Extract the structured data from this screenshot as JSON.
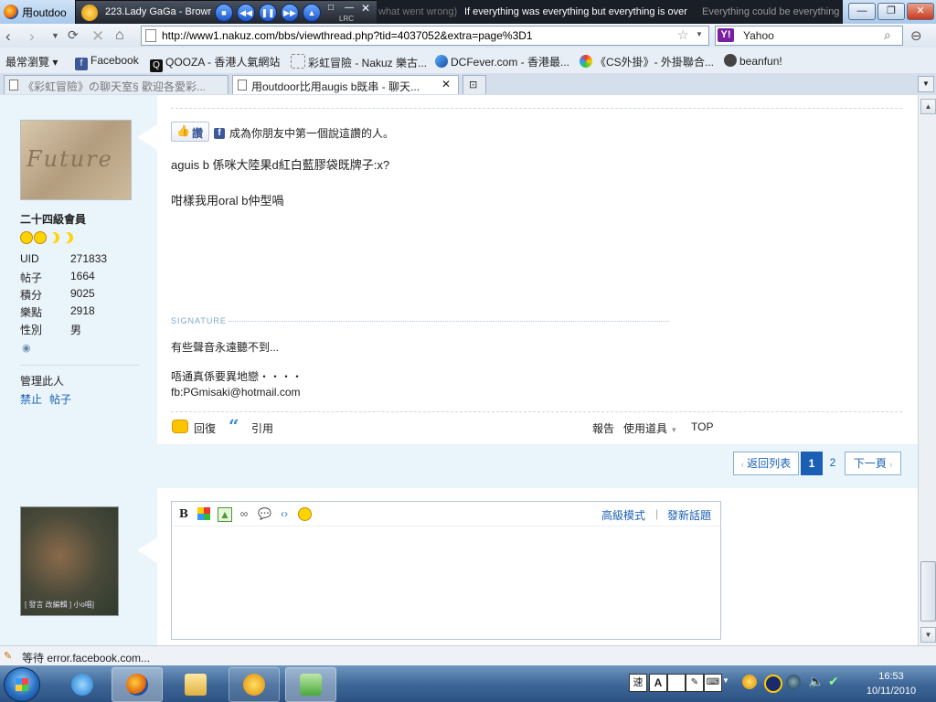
{
  "window": {
    "title": "用outdoo",
    "media_title": "223.Lady GaGa - Browr",
    "lyrics_prev": "what went wrong)",
    "lyrics_current": "If everything was everything but everything is over",
    "lyrics_next": "Everything could be everything",
    "lrc_label": "LRC"
  },
  "nav": {
    "url": "http://www1.nakuz.com/bbs/viewthread.php?tid=4037052&extra=page%3D1",
    "search_engine": "Yahoo"
  },
  "bookmarks": [
    {
      "label": "最常瀏覽",
      "color": "#e8eef6"
    },
    {
      "label": "Facebook",
      "color": "#3b5998"
    },
    {
      "label": "QOOZA - 香港人氣網站",
      "color": "#111111"
    },
    {
      "label": "彩虹冒險 - Nakuz 樂古...",
      "color": "#e8eef6"
    },
    {
      "label": "DCFever.com - 香港最...",
      "color": "#1a73c8"
    },
    {
      "label": "《CS外掛》- 外掛聯合...",
      "color": "#e8eef6"
    },
    {
      "label": "beanfun!",
      "color": "#444444"
    }
  ],
  "tabs": [
    {
      "label": "《彩虹冒險》の聊天室§ 歡迎各愛彩...",
      "active": false
    },
    {
      "label": "用outdoor比用augis b既串 - 聊天...",
      "active": true
    }
  ],
  "post": {
    "like_label": "讚",
    "like_prompt": "成為你朋友中第一個說這讚的人。",
    "line1": "aguis b 係咪大陸果d紅白藍膠袋既牌子:x?",
    "line2": "咁樣我用oral b仲型喎",
    "signature_label": "SIGNATURE",
    "sig1": "有些聲音永遠聽不到...",
    "sig2": "唔通真係要異地戀・・・・",
    "sig3": "fb:PGmisaki@hotmail.com",
    "reply": "回復",
    "quote": "引用",
    "report": "報告",
    "tools": "使用道具",
    "top": "TOP"
  },
  "user": {
    "avatar_text": "Future",
    "rank": "二十四級會員",
    "stats": [
      {
        "k": "UID",
        "v": "271833"
      },
      {
        "k": "帖子",
        "v": "1664"
      },
      {
        "k": "積分",
        "v": "9025"
      },
      {
        "k": "樂點",
        "v": "2918"
      },
      {
        "k": "性別",
        "v": "男"
      }
    ],
    "manage": "管理此人",
    "ban": "禁止",
    "posts": "帖子"
  },
  "pagination": {
    "back": "返回列表",
    "p1": "1",
    "p2": "2",
    "next": "下一頁"
  },
  "editor": {
    "advanced": "高級模式",
    "sep": "|",
    "new_topic": "發新話題",
    "avatar2_caption": "[ 發言 改編輯 ] 小o唱]"
  },
  "status": {
    "text": "等待 error.facebook.com..."
  },
  "taskbar": {
    "time": "16:53",
    "date": "10/11/2010"
  }
}
